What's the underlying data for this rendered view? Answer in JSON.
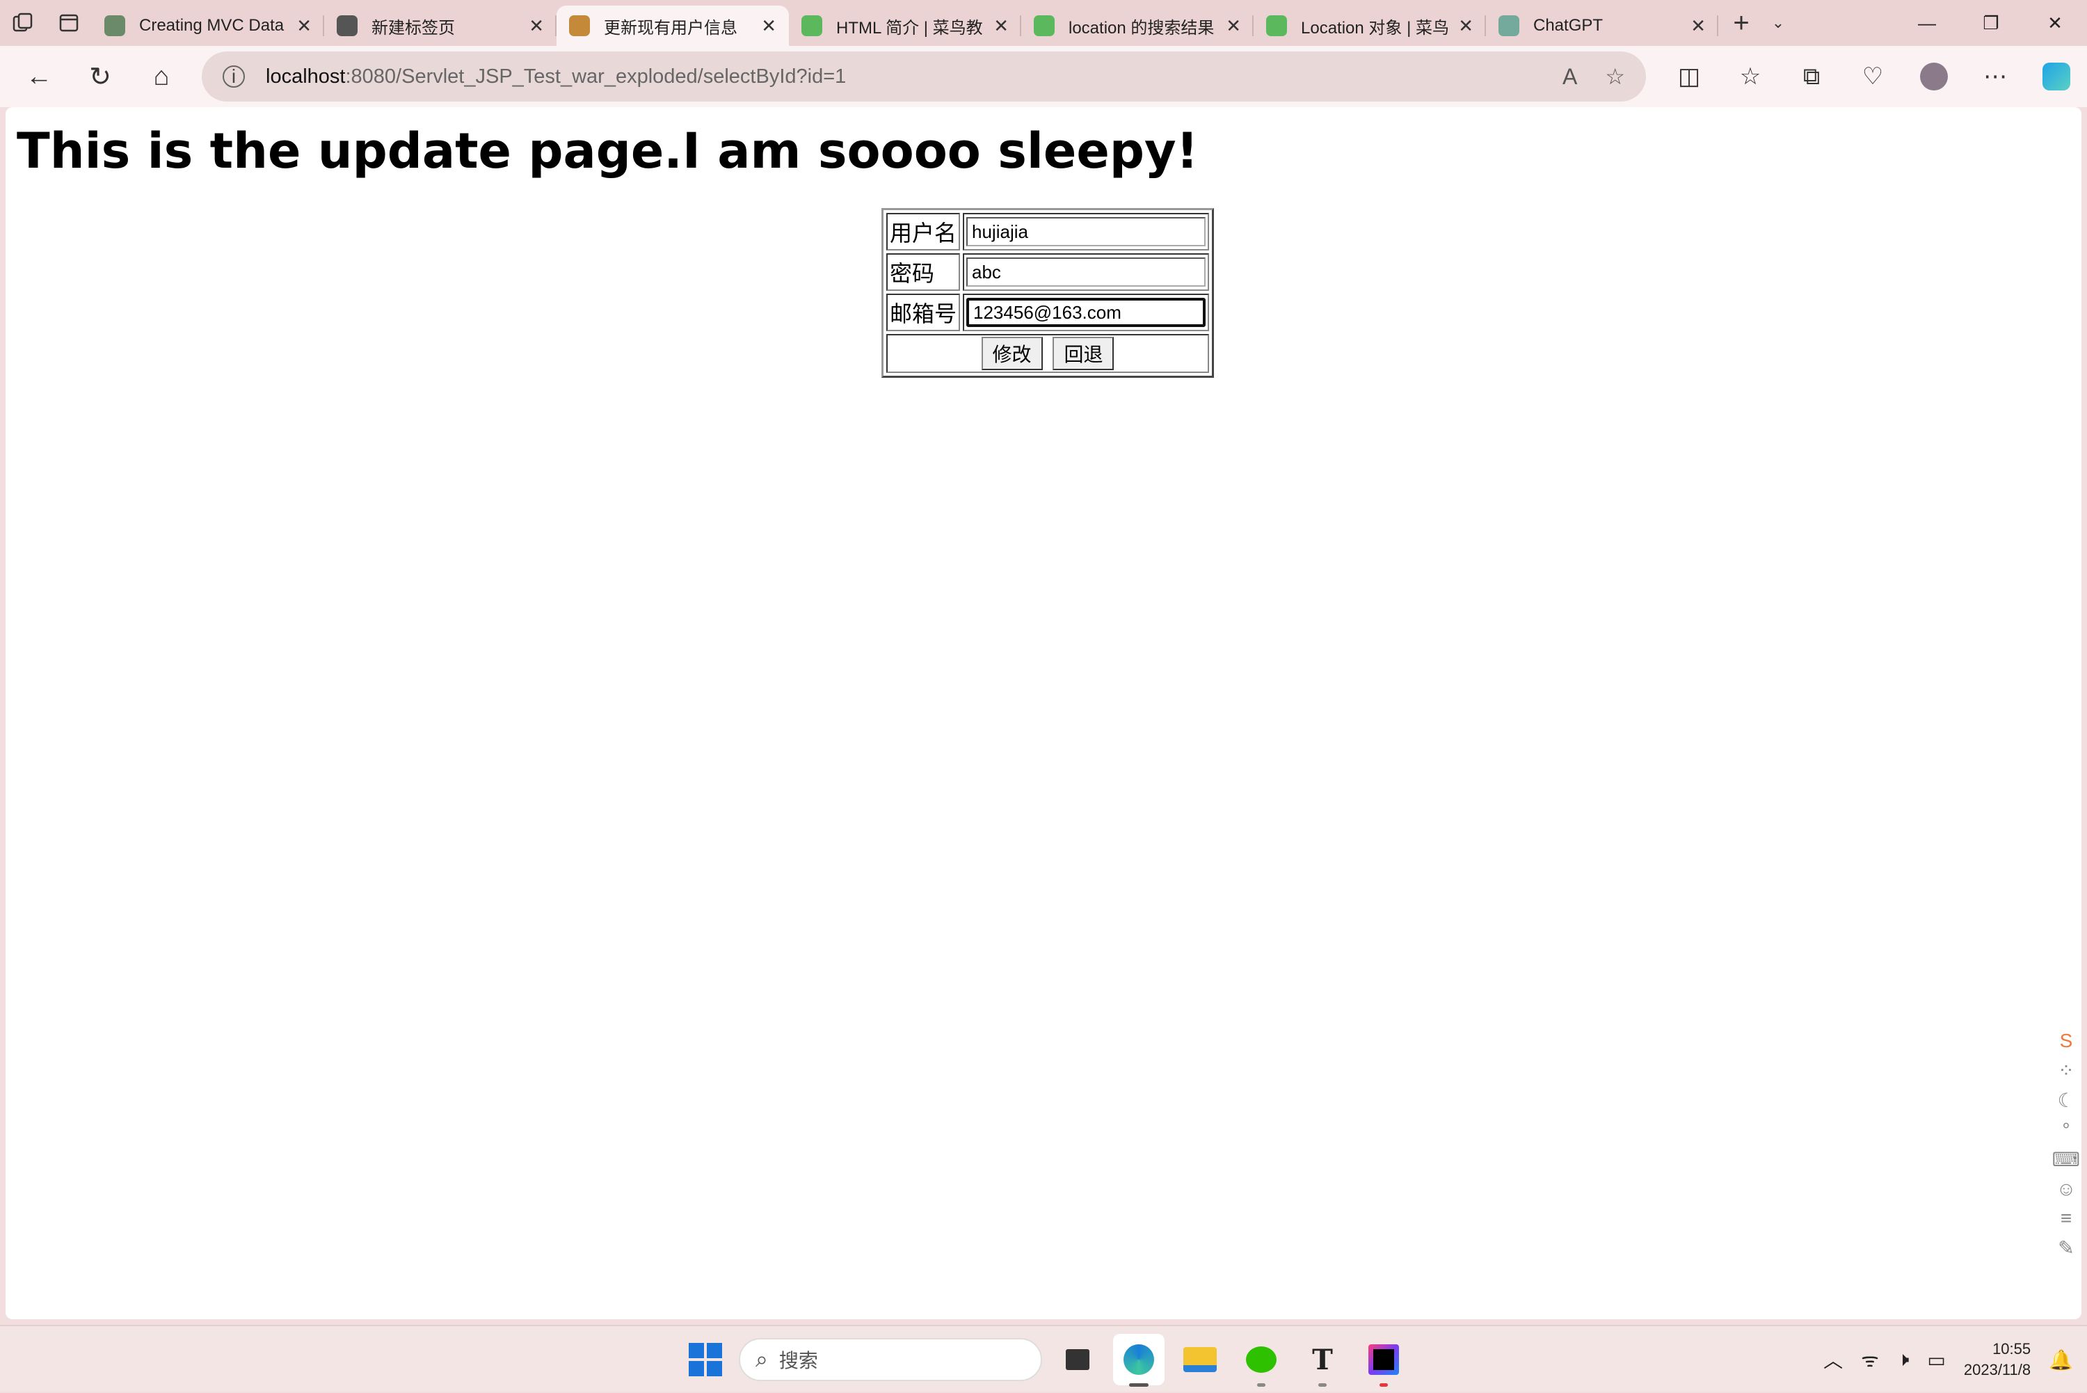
{
  "browser": {
    "tabs": [
      {
        "title": "Creating MVC Data",
        "favicon_color": "#6a8a6a",
        "active": false
      },
      {
        "title": "新建标签页",
        "favicon_color": "#555555",
        "active": false
      },
      {
        "title": "更新现有用户信息",
        "favicon_color": "#c48a3a",
        "active": true
      },
      {
        "title": "HTML 简介 | 菜鸟教",
        "favicon_color": "#5cb85c",
        "active": false
      },
      {
        "title": "location 的搜索结果",
        "favicon_color": "#5cb85c",
        "active": false
      },
      {
        "title": "Location 对象 | 菜鸟",
        "favicon_color": "#5cb85c",
        "active": false
      },
      {
        "title": "ChatGPT",
        "favicon_color": "#74aa9c",
        "active": false
      }
    ],
    "address": {
      "host": "localhost",
      "rest": ":8080/Servlet_JSP_Test_war_exploded/selectById?id=1"
    }
  },
  "page": {
    "title": "This is the update page.I am soooo sleepy!",
    "form": {
      "username_label": "用户名",
      "username_value": "hujiajia",
      "password_label": "密码",
      "password_value": "abc",
      "email_label": "邮箱号",
      "email_value": "123456@163.com",
      "submit_label": "修改",
      "back_label": "回退"
    }
  },
  "taskbar": {
    "search_placeholder": "搜索",
    "time": "10:55",
    "date": "2023/11/8"
  }
}
